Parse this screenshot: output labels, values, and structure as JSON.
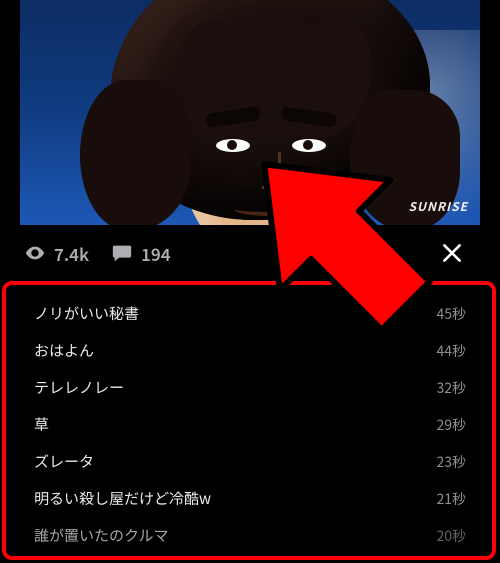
{
  "video": {
    "watermark": "SUNRISE"
  },
  "stats": {
    "views": "7.4k",
    "comments": "194"
  },
  "comments": {
    "partial_top": {
      "text": "",
      "time": ""
    },
    "items": [
      {
        "text": "ノリがいい秘書",
        "time": "45秒"
      },
      {
        "text": "おはよん",
        "time": "44秒"
      },
      {
        "text": "テレレノレー",
        "time": "32秒"
      },
      {
        "text": "草",
        "time": "29秒"
      },
      {
        "text": "ズレータ",
        "time": "23秒"
      },
      {
        "text": "明るい殺し屋だけど冷酷w",
        "time": "21秒"
      },
      {
        "text": "誰が置いたのクルマ",
        "time": "20秒"
      }
    ]
  }
}
